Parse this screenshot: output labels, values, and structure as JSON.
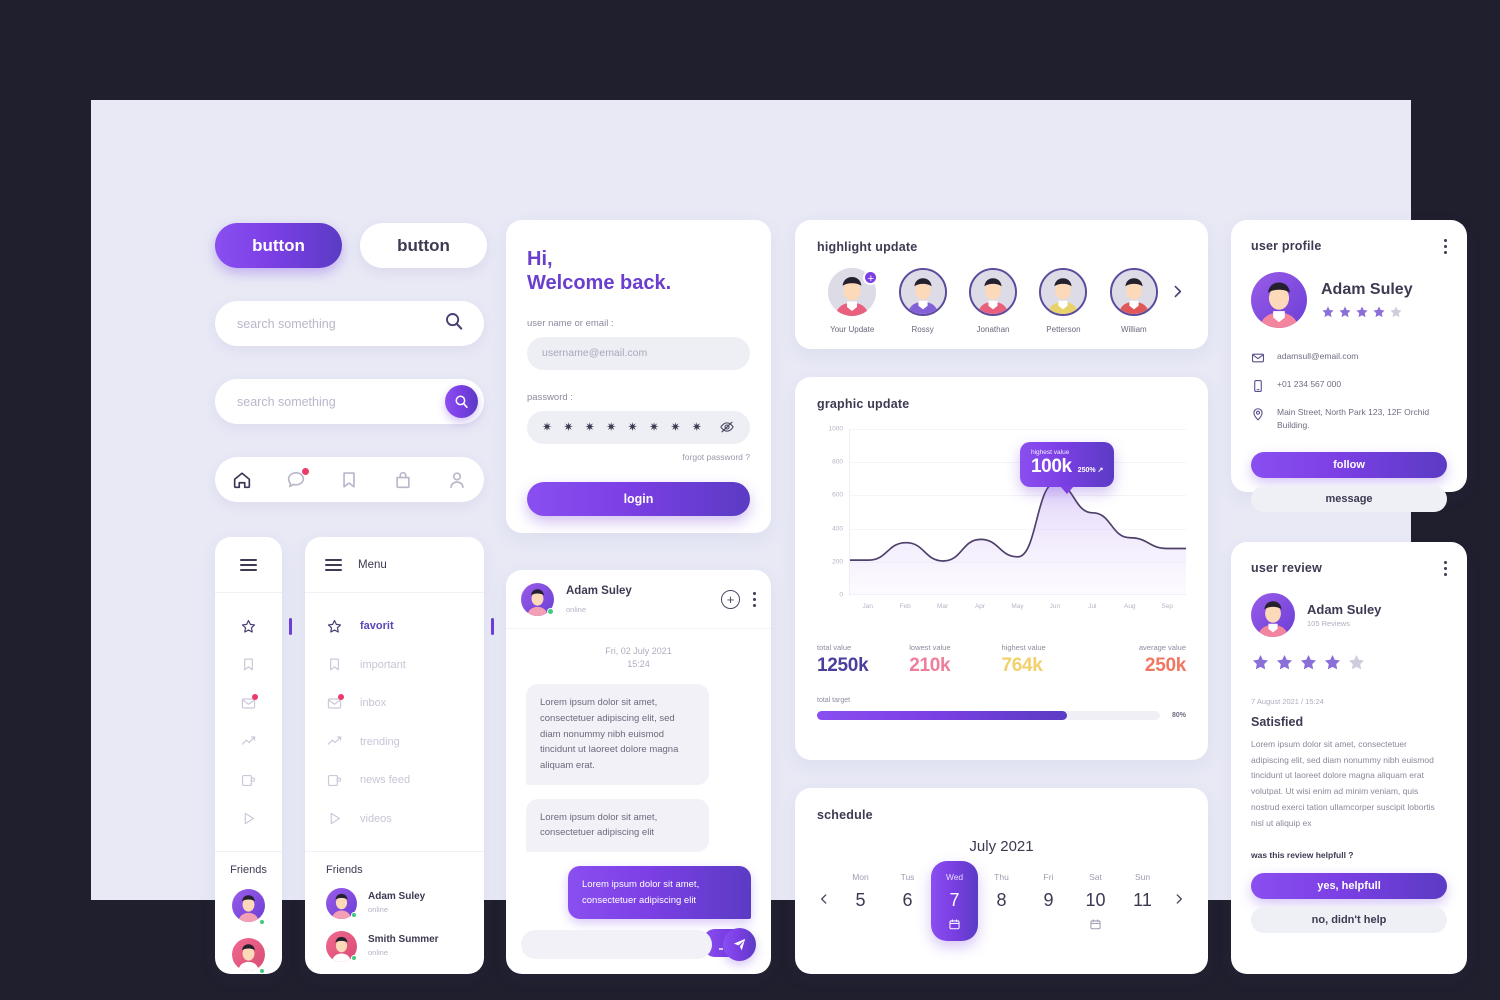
{
  "buttons": {
    "primary": "button",
    "secondary": "button"
  },
  "search": {
    "plain_placeholder": "search something",
    "filled_placeholder": "search something"
  },
  "bottom_nav": [
    {
      "name": "home-icon",
      "active": true
    },
    {
      "name": "chat-icon",
      "badge": true
    },
    {
      "name": "bookmark-icon"
    },
    {
      "name": "bag-icon"
    },
    {
      "name": "profile-icon"
    }
  ],
  "sidebar": {
    "menu_label": "Menu",
    "items": [
      {
        "label": "favorit",
        "icon": "star-icon",
        "active": true
      },
      {
        "label": "important",
        "icon": "bookmark-icon",
        "active": false
      },
      {
        "label": "inbox",
        "icon": "mail-icon",
        "active": false,
        "badge": true
      },
      {
        "label": "trending",
        "icon": "trending-icon",
        "active": false
      },
      {
        "label": "news feed",
        "icon": "news-icon",
        "active": false
      },
      {
        "label": "videos",
        "icon": "play-icon",
        "active": false
      }
    ],
    "friends_title": "Friends",
    "friends": [
      {
        "name": "Adam Suley",
        "status": "online"
      },
      {
        "name": "Smith Summer",
        "status": "online"
      }
    ]
  },
  "login": {
    "greeting_line1": "Hi,",
    "greeting_line2": "Welcome back.",
    "user_label": "user name or email :",
    "user_placeholder": "username@email.com",
    "user_value": "",
    "password_label": "password :",
    "password_mask": "✷ ✷ ✷ ✷ ✷ ✷ ✷ ✷",
    "forgot": "forgot password ?",
    "submit": "login"
  },
  "chat": {
    "name": "Adam Suley",
    "status": "online",
    "date": "Fri, 02 July 2021",
    "time": "15:24",
    "messages": [
      {
        "side": "in",
        "text": "Lorem ipsum dolor sit amet, consectetuer adipiscing elit, sed diam nonummy nibh euismod tincidunt ut laoreet dolore magna aliquam erat."
      },
      {
        "side": "in",
        "text": "Lorem ipsum dolor sit amet, consectetuer adipiscing elit"
      },
      {
        "side": "out",
        "text": "Lorem ipsum dolor sit amet, consectetuer adipiscing elit"
      },
      {
        "side": "out",
        "text": "",
        "typing": true
      }
    ],
    "input_placeholder": ""
  },
  "highlight": {
    "title": "highlight update",
    "items": [
      {
        "name": "Your Update",
        "ring": "none",
        "shirt": "#e8607d",
        "add": "+"
      },
      {
        "name": "Rossy",
        "ring": "#5d4a9e",
        "shirt": "#8460d8"
      },
      {
        "name": "Jonathan",
        "ring": "#5d4a9e",
        "shirt": "#e8607d"
      },
      {
        "name": "Petterson",
        "ring": "#5d4a9e",
        "shirt": "#e8d36a"
      },
      {
        "name": "William",
        "ring": "#5d4a9e",
        "shirt": "#e05757"
      }
    ]
  },
  "graph": {
    "title": "graphic update",
    "tooltip_label": "highest value",
    "tooltip_value": "100k",
    "tooltip_pct": "250% ↗",
    "stats": [
      {
        "label": "total value",
        "value": "1250k",
        "color": "#4b3f9e"
      },
      {
        "label": "lowest value",
        "value": "210k",
        "color": "#ef7d9c"
      },
      {
        "label": "highest value",
        "value": "764k",
        "color": "#f0d16b"
      },
      {
        "label": "average value",
        "value": "250k",
        "color": "#f07762"
      }
    ],
    "target_label": "total target",
    "target_pct": "80%",
    "target_fill": 73
  },
  "chart_data": {
    "type": "area",
    "title": "graphic update",
    "xlabel": "",
    "ylabel": "",
    "x": [
      "Jan",
      "Feb",
      "Mar",
      "Apr",
      "May",
      "Jun",
      "Jul",
      "Aug",
      "Sep"
    ],
    "series": [
      {
        "name": "updates",
        "values": [
          210,
          315,
          205,
          335,
          230,
          675,
          495,
          345,
          280
        ]
      }
    ],
    "ylim": [
      0,
      1000
    ],
    "yticks": [
      0,
      200,
      400,
      600,
      800,
      1000
    ],
    "grid": true,
    "legend": "none",
    "annotations": [
      {
        "at": "Jun",
        "label": "highest value",
        "value": "100k",
        "delta": "250% ↗"
      }
    ],
    "summary": {
      "total value": "1250k",
      "lowest value": "210k",
      "highest value": "764k",
      "average value": "250k",
      "total target": "80%"
    }
  },
  "schedule": {
    "title": "schedule",
    "month": "July 2021",
    "days": [
      {
        "weekday": "Mon",
        "num": "5",
        "selected": false,
        "event": false
      },
      {
        "weekday": "Tus",
        "num": "6",
        "selected": false,
        "event": false
      },
      {
        "weekday": "Wed",
        "num": "7",
        "selected": true,
        "event": true
      },
      {
        "weekday": "Thu",
        "num": "8",
        "selected": false,
        "event": false
      },
      {
        "weekday": "Fri",
        "num": "9",
        "selected": false,
        "event": false
      },
      {
        "weekday": "Sat",
        "num": "10",
        "selected": false,
        "event": true
      },
      {
        "weekday": "Sun",
        "num": "11",
        "selected": false,
        "event": false
      }
    ]
  },
  "profile": {
    "title": "user profile",
    "name": "Adam Suley",
    "rating": 4,
    "email": "adamsull@email.com",
    "phone": "+01 234 567 000",
    "address": "Main Street, North Park 123, 12F Orchid Building.",
    "follow": "follow",
    "message": "message"
  },
  "review": {
    "title": "user review",
    "name": "Adam Suley",
    "count": "105 Reviews",
    "rating": 4,
    "date": "7 August 2021 / 15:24",
    "heading": "Satisfied",
    "body": "Lorem ipsum dolor sit amet, consectetuer adipiscing elit, sed diam nonummy nibh euismod tincidunt ut laoreet dolore magna aliquam erat volutpat. Ut wisi enim ad minim veniam, quis nostrud exerci tation ullamcorper suscipit lobortis nisl ut aliquip ex",
    "question": "was this review helpfull ?",
    "yes": "yes, helpfull",
    "no": "no, didn't help"
  },
  "colors": {
    "accent": "#7b3fe4",
    "accent_dark": "#5b3bc4",
    "page_bg": "#e8e9f5",
    "outer_bg": "#201f2e",
    "star_on": "#8a6fd8",
    "star_off": "#cfcddd"
  }
}
